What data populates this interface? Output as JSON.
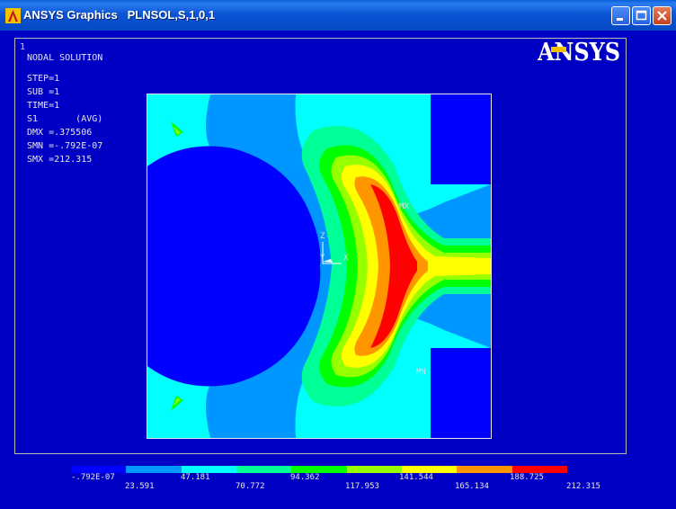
{
  "window": {
    "title": "ANSYS Graphics   PLNSOL,S,1,0,1",
    "window_number": "1"
  },
  "logo_text": "ANSYS",
  "info": {
    "heading": "NODAL SOLUTION",
    "lines": [
      "STEP=1",
      "SUB =1",
      "TIME=1",
      "S1       (AVG)",
      "DMX =.375506",
      "SMN =-.792E-07",
      "SMX =212.315"
    ]
  },
  "markers": {
    "max": "MX",
    "min": "MN"
  },
  "triad": {
    "z": "Z",
    "y": "Y",
    "x": "X"
  },
  "legend": {
    "colors": [
      "#0000ff",
      "#0096ff",
      "#00ffff",
      "#00ff96",
      "#00ff00",
      "#96ff00",
      "#ffff00",
      "#ff9600",
      "#ff0000"
    ],
    "values_top": [
      "-.792E-07",
      "47.181",
      "94.362",
      "141.544",
      "188.725"
    ],
    "values_bottom": [
      "23.591",
      "70.772",
      "117.953",
      "165.134",
      "212.315"
    ]
  },
  "colors": {
    "background": "#0000c4",
    "accent": "#0b55d6"
  }
}
